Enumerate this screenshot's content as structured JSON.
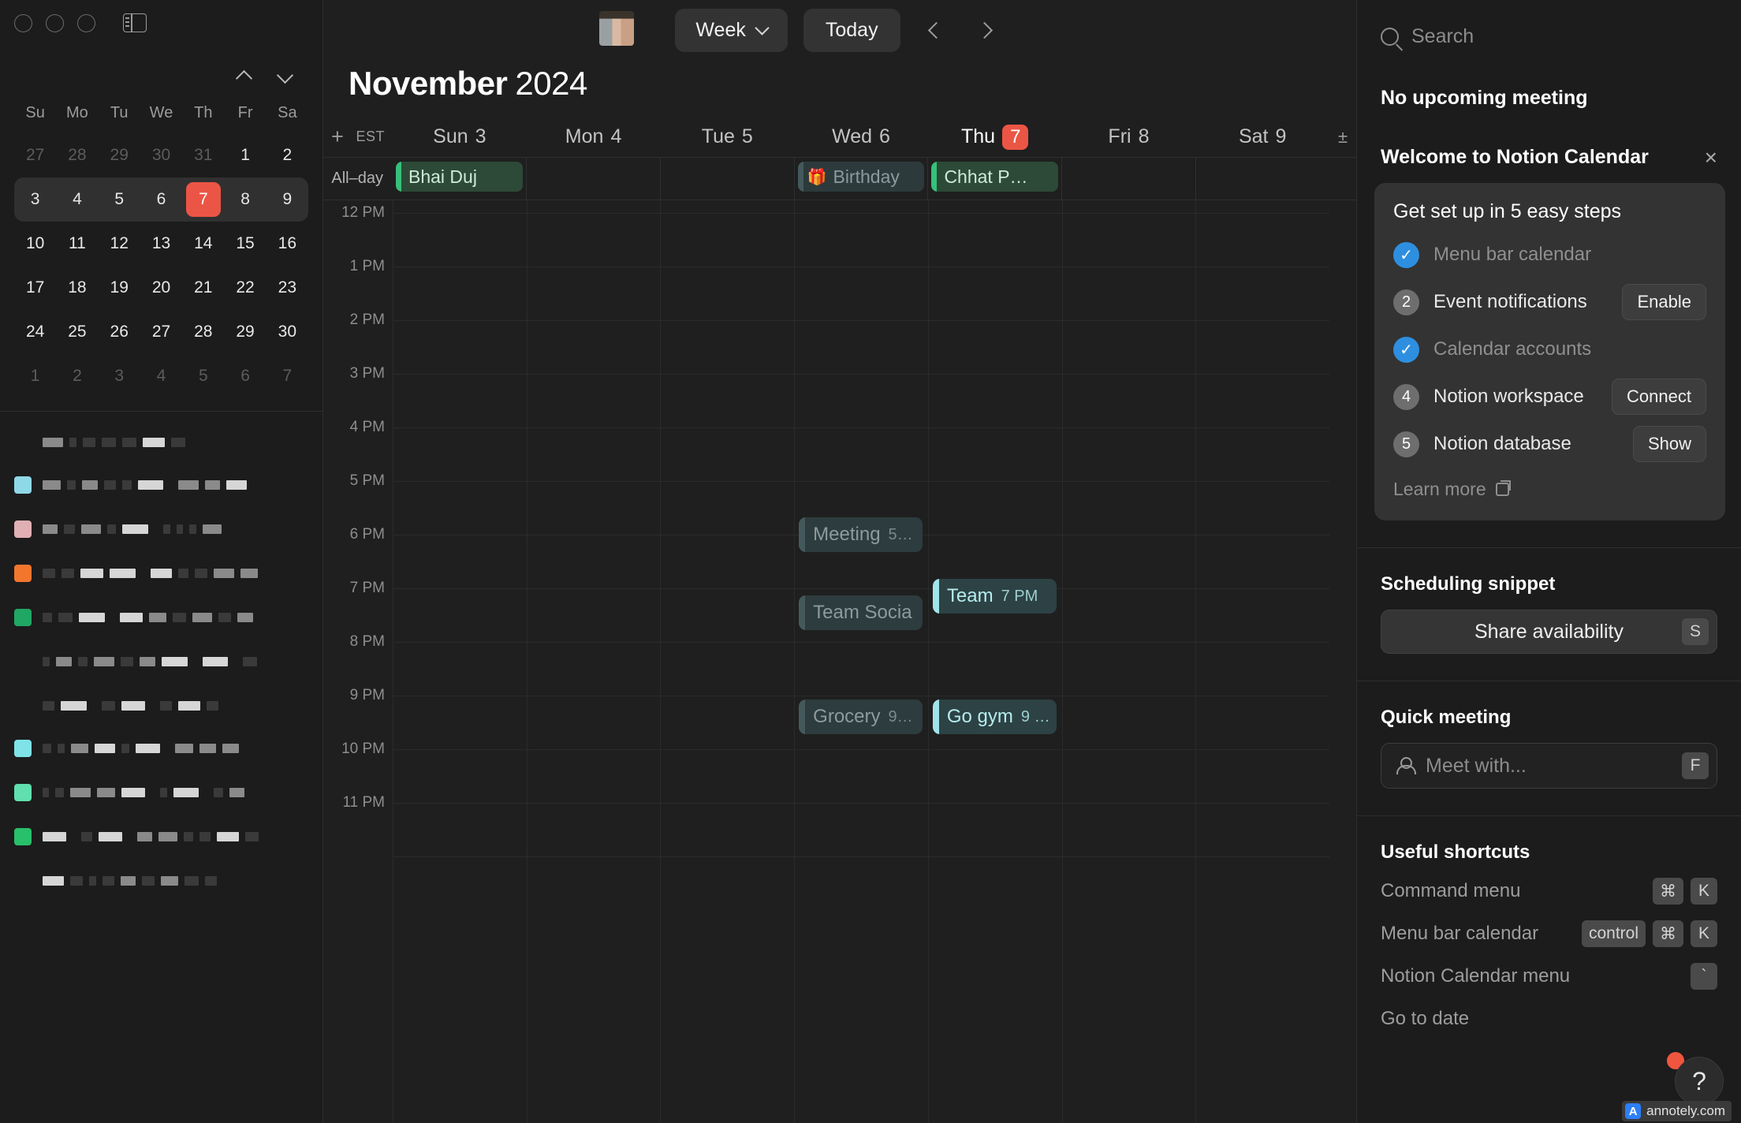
{
  "window": {
    "traffic_lights": [
      "close",
      "minimize",
      "zoom"
    ],
    "sidebar_toggle": "sidebar-toggle-icon"
  },
  "mini_calendar": {
    "day_names": [
      "Su",
      "Mo",
      "Tu",
      "We",
      "Th",
      "Fr",
      "Sa"
    ],
    "weeks": [
      [
        {
          "d": "27",
          "muted": true
        },
        {
          "d": "28",
          "muted": true
        },
        {
          "d": "29",
          "muted": true
        },
        {
          "d": "30",
          "muted": true
        },
        {
          "d": "31",
          "muted": true
        },
        {
          "d": "1"
        },
        {
          "d": "2"
        }
      ],
      [
        {
          "d": "3"
        },
        {
          "d": "4"
        },
        {
          "d": "5"
        },
        {
          "d": "6"
        },
        {
          "d": "7",
          "today": true
        },
        {
          "d": "8"
        },
        {
          "d": "9"
        }
      ],
      [
        {
          "d": "10"
        },
        {
          "d": "11"
        },
        {
          "d": "12"
        },
        {
          "d": "13"
        },
        {
          "d": "14"
        },
        {
          "d": "15"
        },
        {
          "d": "16"
        }
      ],
      [
        {
          "d": "17"
        },
        {
          "d": "18"
        },
        {
          "d": "19"
        },
        {
          "d": "20"
        },
        {
          "d": "21"
        },
        {
          "d": "22"
        },
        {
          "d": "23"
        }
      ],
      [
        {
          "d": "24"
        },
        {
          "d": "25"
        },
        {
          "d": "26"
        },
        {
          "d": "27"
        },
        {
          "d": "28"
        },
        {
          "d": "29"
        },
        {
          "d": "30"
        }
      ],
      [
        {
          "d": "1",
          "muted": true
        },
        {
          "d": "2",
          "muted": true
        },
        {
          "d": "3",
          "muted": true
        },
        {
          "d": "4",
          "muted": true
        },
        {
          "d": "5",
          "muted": true
        },
        {
          "d": "6",
          "muted": true
        },
        {
          "d": "7",
          "muted": true
        }
      ]
    ],
    "selected_week_index": 1,
    "today_color": "#eb5545"
  },
  "calendar_list": {
    "redacted": true,
    "note": "account and calendar names are pixelated/obscured in the screenshot",
    "groups": [
      {
        "header_redacted": true,
        "items": [
          {
            "swatch": "#8fd8e8",
            "redacted": true
          },
          {
            "swatch": "#e0b0b4",
            "redacted": true
          },
          {
            "swatch": "#f2762e",
            "redacted": true
          },
          {
            "swatch": "#21a764",
            "redacted": true
          },
          {
            "swatch": "",
            "redacted": true
          }
        ]
      },
      {
        "header_redacted": true,
        "items": [
          {
            "swatch": "#7fe3e8",
            "redacted": true
          },
          {
            "swatch": "#5fe0ad",
            "redacted": true
          },
          {
            "swatch": "#28c06a",
            "redacted": true
          },
          {
            "swatch": "",
            "redacted": true
          }
        ]
      }
    ]
  },
  "toolbar": {
    "avatar": "user-avatar",
    "view_label": "Week",
    "today_label": "Today",
    "prev_label": "previous-week",
    "next_label": "next-week"
  },
  "header": {
    "month": "November",
    "year": "2024",
    "timezone": "EST",
    "add_label": "+",
    "expand_label": "±",
    "allday_label": "All–day",
    "days": [
      {
        "name": "Sun",
        "num": "3",
        "current": false
      },
      {
        "name": "Mon",
        "num": "4",
        "current": false
      },
      {
        "name": "Tue",
        "num": "5",
        "current": false
      },
      {
        "name": "Wed",
        "num": "6",
        "current": false
      },
      {
        "name": "Thu",
        "num": "7",
        "current": true
      },
      {
        "name": "Fri",
        "num": "8",
        "current": false
      },
      {
        "name": "Sat",
        "num": "9",
        "current": false
      }
    ]
  },
  "all_day_events": [
    {
      "col": 0,
      "title": "Bhai Duj",
      "style": "green",
      "icon": ""
    },
    {
      "col": 3,
      "title": "Birthday",
      "style": "slate",
      "icon": "🎁"
    },
    {
      "col": 4,
      "title": "Chhat P…",
      "style": "green",
      "icon": ""
    }
  ],
  "time_labels": [
    "12 PM",
    "1 PM",
    "2 PM",
    "3 PM",
    "4 PM",
    "5 PM",
    "6 PM",
    "7 PM",
    "8 PM",
    "9 PM",
    "10 PM",
    "11 PM"
  ],
  "events": [
    {
      "col": 3,
      "title": "Meeting",
      "time": "5…",
      "hour": 6.0,
      "style": "past"
    },
    {
      "col": 3,
      "title": "Team Socia",
      "time": "",
      "hour": 7.45,
      "style": "past"
    },
    {
      "col": 4,
      "title": "Team",
      "time": "7 PM",
      "hour": 7.15,
      "style": "live"
    },
    {
      "col": 3,
      "title": "Grocery",
      "time": "9…",
      "hour": 9.4,
      "style": "past"
    },
    {
      "col": 4,
      "title": "Go gym",
      "time": "9 …",
      "hour": 9.4,
      "style": "live"
    }
  ],
  "right_panel": {
    "search": {
      "placeholder": "Search",
      "icon": "search-icon"
    },
    "no_meeting": "No upcoming meeting",
    "welcome": {
      "title": "Welcome to Notion Calendar",
      "close": "×",
      "card_title": "Get set up in 5 easy steps",
      "steps": [
        {
          "num": "1",
          "label": "Menu bar calendar",
          "done": true,
          "action": ""
        },
        {
          "num": "2",
          "label": "Event notifications",
          "done": false,
          "action": "Enable"
        },
        {
          "num": "3",
          "label": "Calendar accounts",
          "done": true,
          "action": ""
        },
        {
          "num": "4",
          "label": "Notion workspace",
          "done": false,
          "action": "Connect"
        },
        {
          "num": "5",
          "label": "Notion database",
          "done": false,
          "action": "Show"
        }
      ],
      "learn_more": "Learn more"
    },
    "scheduling": {
      "title": "Scheduling snippet",
      "button": "Share availability",
      "key": "S"
    },
    "quick_meeting": {
      "title": "Quick meeting",
      "placeholder": "Meet with...",
      "key": "F"
    },
    "shortcuts": {
      "title": "Useful shortcuts",
      "rows": [
        {
          "name": "Command menu",
          "keys": [
            "⌘",
            "K"
          ]
        },
        {
          "name": "Menu bar calendar",
          "keys": [
            "control",
            "⌘",
            "K"
          ]
        },
        {
          "name": "Notion Calendar menu",
          "keys": [
            "`"
          ]
        },
        {
          "name": "Go to date",
          "keys": []
        }
      ]
    },
    "help": "?",
    "watermark": {
      "mark": "A",
      "text": "annotely.com"
    }
  }
}
